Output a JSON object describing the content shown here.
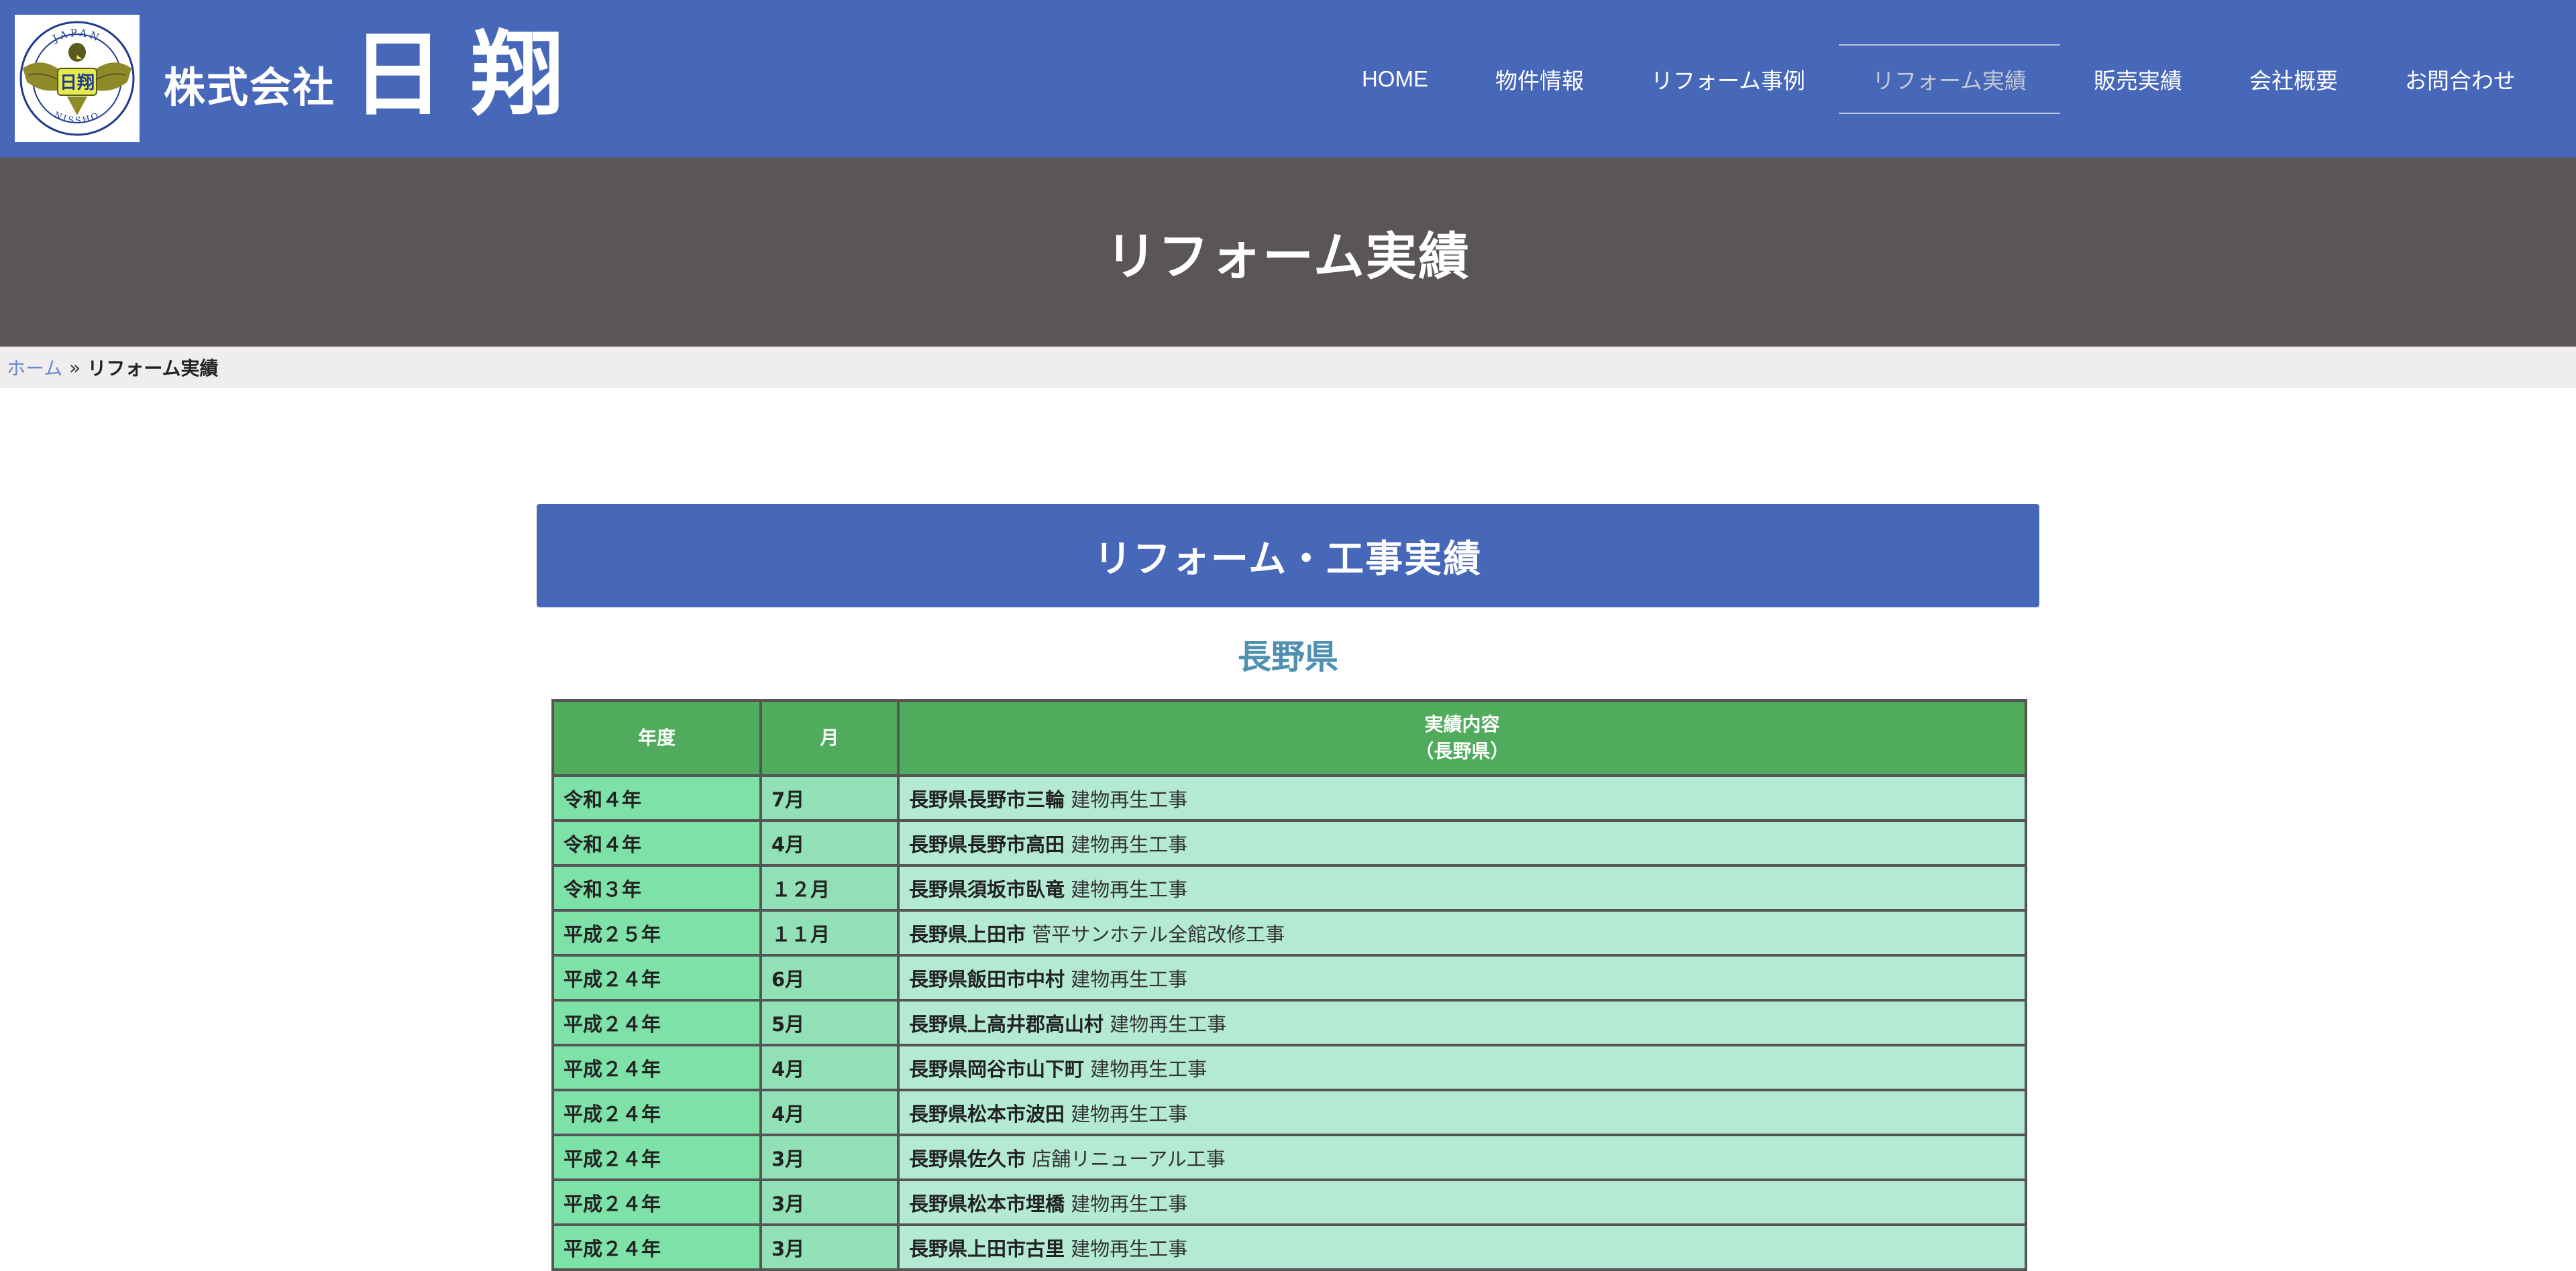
{
  "header": {
    "logo": {
      "top_text": "JAPAN",
      "center_text": "日翔",
      "bottom_text": "NISSHO",
      "colors": {
        "ring": "#1f3a8c",
        "bird": "#8e8a2a",
        "bird_dark": "#5a5a1e",
        "center": "#e7ea4c"
      }
    },
    "brand_prefix": "株式会社",
    "brand_name": "日翔",
    "background": "#4767b8"
  },
  "nav": {
    "items": [
      {
        "label": "HOME"
      },
      {
        "label": "物件情報"
      },
      {
        "label": "リフォーム事例"
      },
      {
        "label": "リフォーム実績",
        "active": true
      },
      {
        "label": "販売実績"
      },
      {
        "label": "会社概要"
      },
      {
        "label": "お問合わせ"
      }
    ]
  },
  "hero": {
    "title": "リフォーム実績",
    "background": "#595655"
  },
  "breadcrumb": {
    "home": "ホーム",
    "separator": "»",
    "current": "リフォーム実績"
  },
  "section": {
    "title": "リフォーム・工事実績",
    "prefecture": "長野県"
  },
  "table": {
    "headers": {
      "year": "年度",
      "month": "月",
      "detail_line1": "実績内容",
      "detail_line2": "（長野県）"
    },
    "rows": [
      {
        "year": "令和４年",
        "month": "7月",
        "location": "長野県長野市三輪",
        "work": "建物再生工事"
      },
      {
        "year": "令和４年",
        "month": "4月",
        "location": "長野県長野市高田",
        "work": "建物再生工事"
      },
      {
        "year": "令和３年",
        "month": "１２月",
        "location": "長野県須坂市臥竜",
        "work": "建物再生工事"
      },
      {
        "year": "平成２５年",
        "month": "１１月",
        "location": "長野県上田市",
        "work": "菅平サンホテル全館改修工事"
      },
      {
        "year": "平成２４年",
        "month": "6月",
        "location": "長野県飯田市中村",
        "work": "建物再生工事"
      },
      {
        "year": "平成２４年",
        "month": "5月",
        "location": "長野県上高井郡高山村",
        "work": "建物再生工事"
      },
      {
        "year": "平成２４年",
        "month": "4月",
        "location": "長野県岡谷市山下町",
        "work": "建物再生工事"
      },
      {
        "year": "平成２４年",
        "month": "4月",
        "location": "長野県松本市波田",
        "work": "建物再生工事"
      },
      {
        "year": "平成２４年",
        "month": "3月",
        "location": "長野県佐久市",
        "work": "店舗リニューアル工事"
      },
      {
        "year": "平成２４年",
        "month": "3月",
        "location": "長野県松本市埋橋",
        "work": "建物再生工事"
      },
      {
        "year": "平成２４年",
        "month": "3月",
        "location": "長野県上田市古里",
        "work": "建物再生工事"
      }
    ]
  }
}
